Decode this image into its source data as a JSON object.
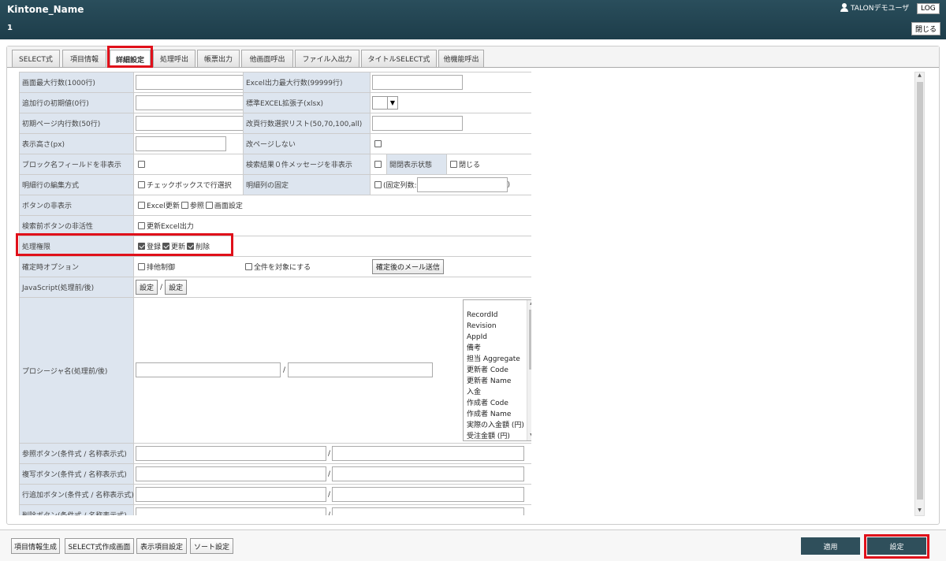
{
  "header": {
    "app_title": "Kintone_Name",
    "record_no": "1",
    "user_name": "TALONデモユーザ",
    "log_button": "LOG",
    "close_button": "閉じる"
  },
  "tabs": [
    {
      "label": "SELECT式",
      "active": false
    },
    {
      "label": "項目情報",
      "active": false
    },
    {
      "label": "詳細設定",
      "active": true
    },
    {
      "label": "処理呼出",
      "active": false
    },
    {
      "label": "帳票出力",
      "active": false
    },
    {
      "label": "他画面呼出",
      "active": false
    },
    {
      "label": "ファイル入出力",
      "active": false
    },
    {
      "label": "タイトルSELECT式",
      "active": false
    },
    {
      "label": "他機能呼出",
      "active": false
    }
  ],
  "form": {
    "max_rows_label": "画面最大行数(1000行)",
    "excel_max_rows_label": "Excel出力最大行数(99999行)",
    "add_rows_label": "追加行の初期値(0行)",
    "excel_ext_label": "標準EXCEL拡張子(xlsx)",
    "page_rows_label": "初期ページ内行数(50行)",
    "page_row_list_label": "改頁行数選択リスト(50,70,100,all)",
    "height_label": "表示高さ(px)",
    "no_page_break_label": "改ページしない",
    "hide_block_label": "ブロック名フィールドを非表示",
    "hide_no_result_label": "検索結果０件メッセージを非表示",
    "open_state_label": "開閉表示状態",
    "close_label": "閉じる",
    "detail_edit_label": "明細行の編集方式",
    "checkbox_select_label": "チェックボックスで行選択",
    "fix_columns_label": "明細列の固定",
    "fix_count_prefix": "(固定列数:",
    "fix_count_suffix": ")",
    "hide_buttons_label": "ボタンの非表示",
    "hide_excel_update": "Excel更新",
    "hide_reference": "参照",
    "hide_screen_setting": "画面設定",
    "disable_before_search_label": "検索前ボタンの非活性",
    "update_excel_output": "更新Excel出力",
    "permission_label": "処理権限",
    "perm_register": "登録",
    "perm_update": "更新",
    "perm_delete": "削除",
    "confirm_option_label": "確定時オプション",
    "exclusive_control": "排他制御",
    "all_records": "全件を対象にする",
    "post_confirm_mail": "確定後のメール送信",
    "javascript_label": "JavaScript(処理前/後)",
    "js_set_before": "設定",
    "slash": "/",
    "js_set_after": "設定",
    "procedure_label": "プロシージャ名(処理前/後)",
    "ref_button_label": "参照ボタン(条件式 / 名称表示式)",
    "copy_button_label": "複写ボタン(条件式 / 名称表示式)",
    "add_row_button_label": "行追加ボタン(条件式 / 名称表示式)",
    "delete_button_label": "削除ボタン(条件式 / 名称表示式)"
  },
  "field_list": [
    "RecordId",
    "Revision",
    "AppId",
    "備考",
    "担当 Aggregate",
    "更新者 Code",
    "更新者 Name",
    "入金",
    "作成者 Code",
    "作成者 Name",
    "実際の入金額 (円)",
    "受注金額 (円)"
  ],
  "bottom": {
    "gen_item_info": "項目情報生成",
    "select_builder": "SELECT式作成画面",
    "display_items": "表示項目設定",
    "sort_settings": "ソート設定",
    "apply": "適用",
    "settings": "設定"
  },
  "colors": {
    "header_bg": "#1d3d4a",
    "highlight": "#e0101a",
    "label_bg": "#dde5ef",
    "primary_button": "#2f4f5b"
  }
}
